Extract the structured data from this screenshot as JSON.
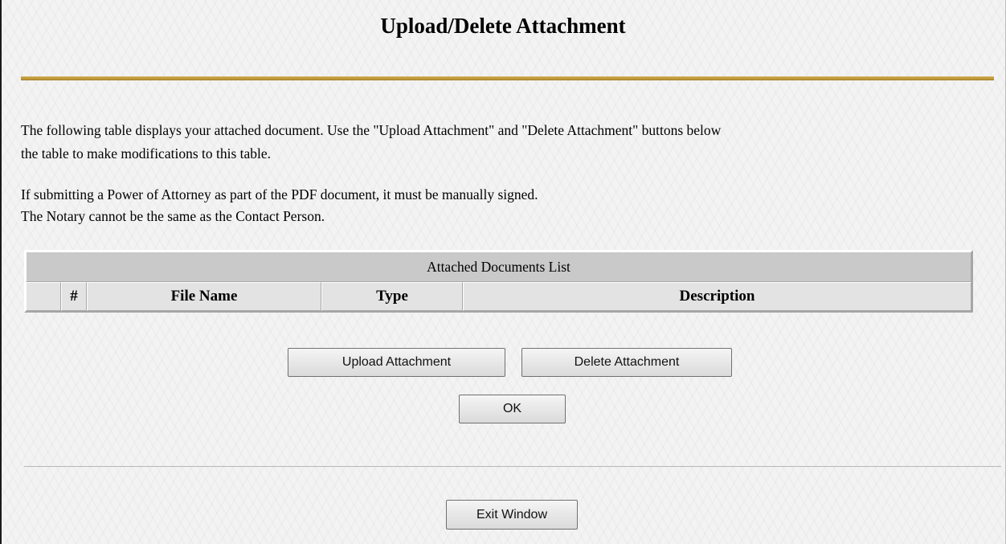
{
  "page": {
    "title": "Upload/Delete Attachment",
    "intro_line1": "The following table displays your attached document.  Use the \"Upload Attachment\" and \"Delete Attachment\" buttons below",
    "intro_line2": "the table to make modifications to this table.",
    "notice_line1": "If submitting a Power of Attorney as part of the PDF document, it must be manually signed.",
    "notice_line2": "The Notary cannot be the same as the Contact Person."
  },
  "table": {
    "caption": "Attached Documents List",
    "columns": [
      "",
      "#",
      "File Name",
      "Type",
      "Description"
    ],
    "rows": []
  },
  "buttons": {
    "upload": "Upload Attachment",
    "delete": "Delete Attachment",
    "ok": "OK",
    "exit": "Exit Window"
  },
  "colors": {
    "title_rule": "#c39b3c",
    "table_caption_bg": "#c9c9c9",
    "table_header_bg": "#e3e3e3",
    "page_bg": "#f3f3f3"
  }
}
